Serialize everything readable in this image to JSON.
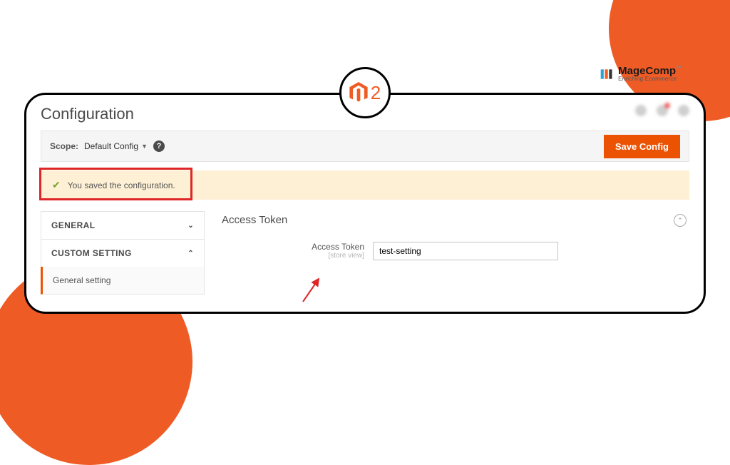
{
  "brand": {
    "name": "MageComp",
    "tagline": "Enriching Ecommerce"
  },
  "badge": {
    "product_version": "2"
  },
  "page": {
    "title": "Configuration"
  },
  "scopebar": {
    "scope_label": "Scope:",
    "scope_value": "Default Config",
    "save_button": "Save Config"
  },
  "message": {
    "text": "You saved the configuration."
  },
  "sidebar": {
    "items": [
      {
        "label": "GENERAL",
        "expanded": false
      },
      {
        "label": "CUSTOM SETTING",
        "expanded": true
      }
    ],
    "sub_item": "General setting"
  },
  "section": {
    "title": "Access Token",
    "field_label": "Access Token",
    "field_hint": "[store view]",
    "field_value": "test-setting"
  }
}
